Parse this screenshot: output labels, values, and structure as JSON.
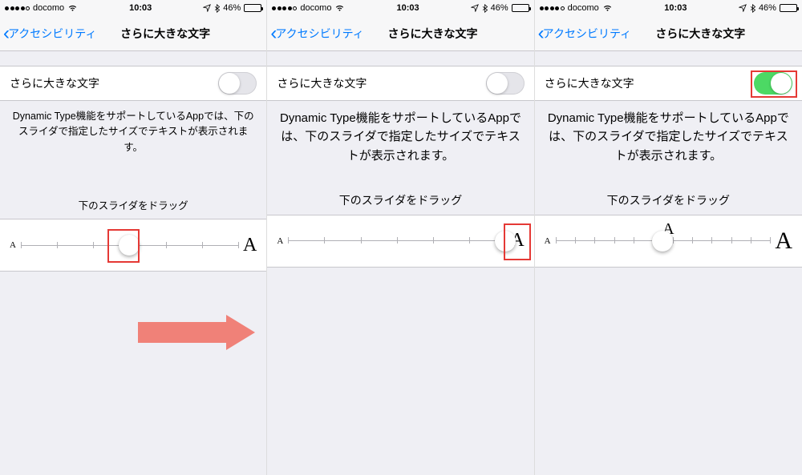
{
  "status": {
    "carrier": "docomo",
    "time": "10:03",
    "battery_percent": "46%"
  },
  "nav": {
    "back_label": "アクセシビリティ",
    "title": "さらに大きな文字"
  },
  "row": {
    "toggle_label": "さらに大きな文字"
  },
  "description": "Dynamic Type機能をサポートしているAppでは、下のスライダで指定したサイズでテキストが表示されます。",
  "instruction": "下のスライダをドラッグ",
  "slider": {
    "small_label": "A",
    "large_label": "A",
    "mid_label": "A"
  },
  "screens": [
    {
      "toggle_on": false,
      "thumb_pct": 50,
      "desc_class": "desc-1",
      "instr_class": "instr-1",
      "show_mid_A": false,
      "big_A_class": "a-large",
      "ticks": 7,
      "highlight_thumb": true,
      "highlight_bigA": false,
      "highlight_switch": false,
      "show_arrow": true
    },
    {
      "toggle_on": false,
      "thumb_pct": 100,
      "desc_class": "desc-2",
      "instr_class": "instr-2",
      "show_mid_A": false,
      "big_A_class": "a-large",
      "ticks": 7,
      "highlight_thumb": false,
      "highlight_bigA": true,
      "highlight_switch": false,
      "show_arrow": false
    },
    {
      "toggle_on": true,
      "thumb_pct": 50,
      "desc_class": "desc-2",
      "instr_class": "instr-2",
      "show_mid_A": true,
      "big_A_class": "a-large bigger",
      "ticks": 12,
      "highlight_thumb": false,
      "highlight_bigA": false,
      "highlight_switch": true,
      "show_arrow": false
    }
  ]
}
